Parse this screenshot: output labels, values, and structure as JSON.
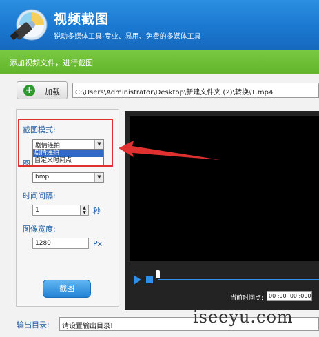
{
  "header": {
    "title": "视频截图",
    "subtitle": "锐动多媒体工具-专业、易用、免费的多媒体工具",
    "logo_icon": "video-camera-disc-icon"
  },
  "instruction_bar": {
    "text": "添加视频文件，进行截图"
  },
  "file": {
    "add_label": "加载",
    "add_icon": "plus-icon",
    "path": "C:\\Users\\Administrator\\Desktop\\新建文件夹 (2)\\转换\\1.mp4"
  },
  "settings": {
    "mode_label": "截图模式:",
    "mode_value": "剧情连拍",
    "mode_options": [
      "剧情连拍",
      "自定义时间点"
    ],
    "format_label_partial": "图",
    "format_value": "bmp",
    "interval_label": "时间间隔:",
    "interval_value": "1",
    "interval_unit": "秒",
    "width_label": "图像宽度:",
    "width_value": "1280",
    "width_unit": "Px",
    "capture_label": "截图"
  },
  "player": {
    "current_time_label": "当前时间点:",
    "current_time_value": "00 :00 :00 :000",
    "accent_color": "#2f8fe8"
  },
  "output": {
    "label": "输出目录:",
    "placeholder": "请设置输出目录!"
  },
  "watermark": "iseeyu.com",
  "colors": {
    "header_blue": "#1a78d0",
    "instruction_green": "#62b52a",
    "highlight_red": "#e03030"
  }
}
